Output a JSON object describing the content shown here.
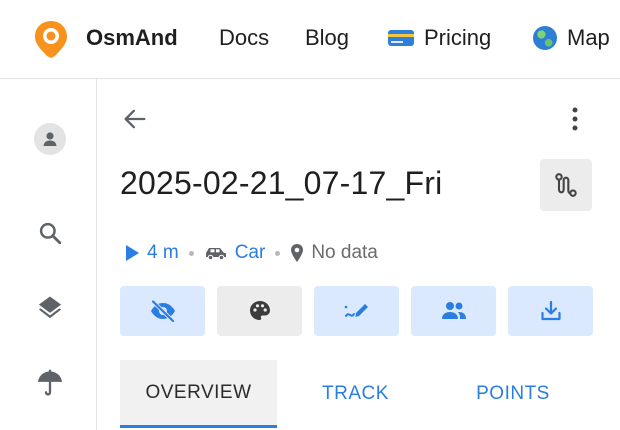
{
  "nav": {
    "brand": "OsmAnd",
    "links": [
      {
        "label": "Docs"
      },
      {
        "label": "Blog"
      },
      {
        "label": "Pricing",
        "icon": "credit-card-icon"
      },
      {
        "label": "Map",
        "icon": "globe-icon"
      }
    ],
    "logo_icon": "osmand-logo-icon"
  },
  "rail": {
    "items": [
      {
        "icon": "profile-icon"
      },
      {
        "icon": "search-icon"
      },
      {
        "icon": "layers-icon"
      },
      {
        "icon": "weather-umbrella-icon"
      }
    ]
  },
  "track": {
    "title": "2025-02-21_07-17_Fri",
    "duration": "4 m",
    "profile": "Car",
    "location": "No data"
  },
  "actions": [
    {
      "icon": "visibility-off-icon",
      "style": "blue"
    },
    {
      "icon": "palette-icon",
      "style": "grey"
    },
    {
      "icon": "edit-track-icon",
      "style": "blue"
    },
    {
      "icon": "share-people-icon",
      "style": "blue"
    },
    {
      "icon": "download-icon",
      "style": "blue"
    }
  ],
  "tabs": [
    {
      "label": "OVERVIEW",
      "active": true
    },
    {
      "label": "TRACK",
      "active": false
    },
    {
      "label": "POINTS",
      "active": false
    }
  ],
  "colors": {
    "accent": "#2a7de1",
    "brand_orange": "#f7931d",
    "active_tab_bg": "#f1f1f1",
    "action_blue_bg": "#dbe9ff"
  }
}
